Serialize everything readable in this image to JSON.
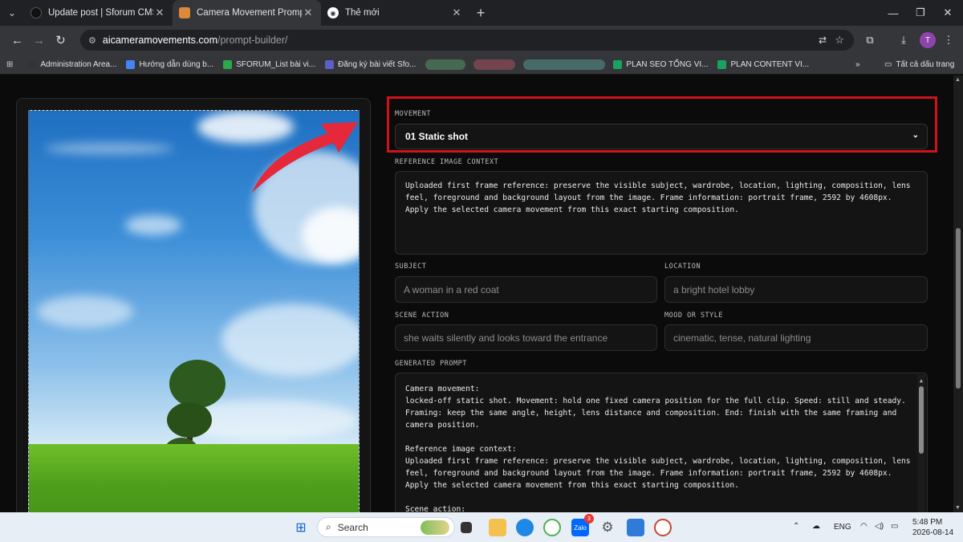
{
  "tabs": [
    {
      "title": "Update post | Sforum CMS",
      "active": false
    },
    {
      "title": "Camera Movement Prompt Buil",
      "active": true
    },
    {
      "title": "Thẻ mới",
      "active": false
    }
  ],
  "address": {
    "host": "aicameramovements.com",
    "path": "/prompt-builder/"
  },
  "bookmarks": [
    "Administration Area...",
    "Hướng dẫn dùng b...",
    "SFORUM_List bài vi...",
    "Đăng ký bài viết Sfo...",
    "PLAN SEO TỔNG VI...",
    "PLAN CONTENT VI..."
  ],
  "bookmarks_overflow": "»",
  "all_bookmarks": "Tất cả dấu trang",
  "avatar_letter": "T",
  "form": {
    "movement_label": "MOVEMENT",
    "movement_value": "01 Static shot",
    "ref_label": "REFERENCE IMAGE CONTEXT",
    "ref_value": "Uploaded first frame reference: preserve the visible subject, wardrobe, location, lighting, composition, lens feel, foreground and background layout from the image. Frame information: portrait frame, 2592 by 4608px. Apply the selected camera movement from this exact starting composition.",
    "subject_label": "SUBJECT",
    "subject_placeholder": "A woman in a red coat",
    "location_label": "LOCATION",
    "location_placeholder": "a bright hotel lobby",
    "action_label": "SCENE ACTION",
    "action_placeholder": "she waits silently and looks toward the entrance",
    "mood_label": "MOOD OR STYLE",
    "mood_placeholder": "cinematic, tense, natural lighting",
    "generated_label": "GENERATED PROMPT",
    "generated_lines": [
      "Camera movement:",
      "locked-off static shot. Movement: hold one fixed camera position for the full clip. Speed: still and steady.",
      "Framing: keep the same angle, height, lens distance and composition. End: finish with the same framing and",
      "camera position.",
      "",
      "Reference image context:",
      "Uploaded first frame reference: preserve the visible subject, wardrobe, location, lighting, composition, lens",
      "feel, foreground and background layout from the image. Frame information: portrait frame, 2592 by 4608px.",
      "Apply the selected camera movement from this exact starting composition.",
      "",
      "Scene action:"
    ]
  },
  "taskbar": {
    "search_label": "Search",
    "zalo_badge": "3",
    "lang": "ENG",
    "time": "5:48 PM",
    "date": "2026-08-14"
  },
  "colors": {
    "highlight": "#d0121b",
    "arrow": "#e5283a"
  }
}
